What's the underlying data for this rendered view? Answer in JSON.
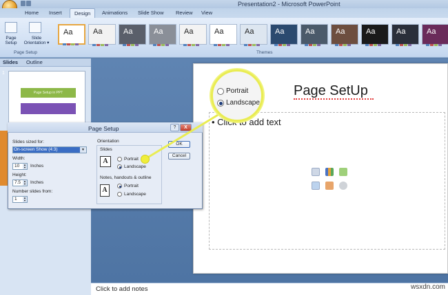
{
  "window": {
    "title": "Presentation2 - Microsoft PowerPoint"
  },
  "tabs": [
    "Home",
    "Insert",
    "Design",
    "Animations",
    "Slide Show",
    "Review",
    "View"
  ],
  "active_tab": "Design",
  "ribbon": {
    "page_setup_group": {
      "label": "Page Setup",
      "buttons": [
        {
          "label_line1": "Page",
          "label_line2": "Setup"
        },
        {
          "label_line1": "Slide",
          "label_line2": "Orientation ▾"
        }
      ]
    },
    "themes_group": {
      "label": "Themes",
      "theme_sample": "Aa"
    }
  },
  "left_pane": {
    "tabs": [
      "Slides",
      "Outline"
    ],
    "slide1": {
      "number": "1",
      "bar_text": "Page Setup in PPT"
    }
  },
  "slide": {
    "title": "Page SetUp",
    "bullet": "Click to add text"
  },
  "magnifier": {
    "portrait": "Portrait",
    "landscape": "Landscape"
  },
  "notes": {
    "placeholder": "Click to add notes"
  },
  "watermark": "wsxdn.com",
  "dialog": {
    "title": "Page Setup",
    "help": "?",
    "close": "X",
    "sized_for_label": "Slides sized for:",
    "sized_for_value": "On-screen Show (4:3)",
    "width_label": "Width:",
    "width_value": "10",
    "width_unit": "Inches",
    "height_label": "Height:",
    "height_value": "7.5",
    "height_unit": "Inches",
    "number_from_label": "Number slides from:",
    "number_from_value": "1",
    "orientation_label": "Orientation",
    "slides_label": "Slides",
    "slides_portrait": "Portrait",
    "slides_landscape": "Landscape",
    "notes_label": "Notes, handouts & outline",
    "notes_portrait": "Portrait",
    "notes_landscape": "Landscape",
    "ok": "OK",
    "cancel": "Cancel",
    "slides_selected": "Landscape",
    "notes_selected": "Portrait"
  },
  "colors": {
    "accent_callout": "#e9ec52",
    "title_bar": "#c5d6ea",
    "slide_bg": "#ffffff"
  }
}
